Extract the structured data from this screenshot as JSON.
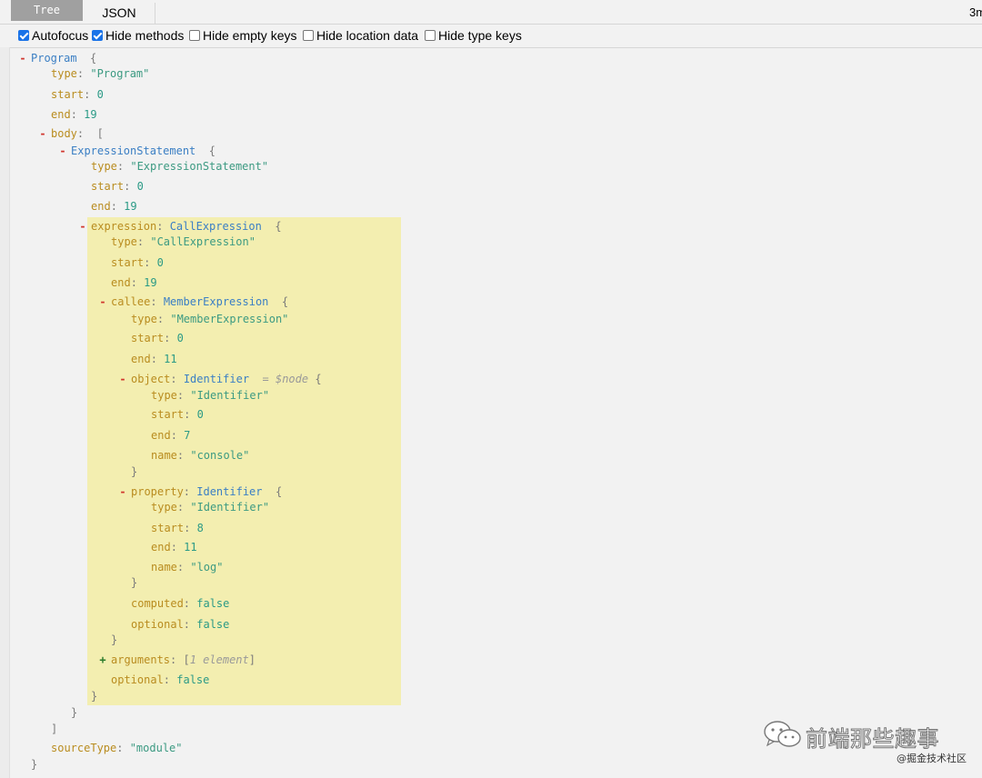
{
  "tabs": {
    "tree": "Tree",
    "json": "JSON",
    "timing": "3m"
  },
  "options": [
    {
      "label": "Autofocus",
      "checked": true
    },
    {
      "label": "Hide methods",
      "checked": true
    },
    {
      "label": "Hide empty keys",
      "checked": false
    },
    {
      "label": "Hide location data",
      "checked": false
    },
    {
      "label": "Hide type keys",
      "checked": false
    }
  ],
  "tree": {
    "program": {
      "label": "Program",
      "open": "{",
      "close": "}"
    },
    "type_key": "type",
    "start_key": "start",
    "end_key": "end",
    "body_key": "body",
    "name_key": "name",
    "computed_key": "computed",
    "optional_key": "optional",
    "sourcetype_key": "sourceType",
    "expression_key": "expression",
    "callee_key": "callee",
    "object_key": "object",
    "property_key": "property",
    "arguments_key": "arguments",
    "program_type": "\"Program\"",
    "program_start": "0",
    "program_end": "19",
    "body_open": "[",
    "body_close": "]",
    "exprstmt_label": "ExpressionStatement",
    "exprstmt_type": "\"ExpressionStatement\"",
    "exprstmt_start": "0",
    "exprstmt_end": "19",
    "call_label": "CallExpression",
    "call_type": "\"CallExpression\"",
    "call_start": "0",
    "call_end": "19",
    "member_label": "MemberExpression",
    "member_type": "\"MemberExpression\"",
    "member_start": "0",
    "member_end": "11",
    "object_label": "Identifier",
    "object_node_ref": "= $node",
    "object_type": "\"Identifier\"",
    "object_start": "0",
    "object_end": "7",
    "object_name": "\"console\"",
    "property_label": "Identifier",
    "property_type": "\"Identifier\"",
    "property_start": "8",
    "property_end": "11",
    "property_name": "\"log\"",
    "computed_value": "false",
    "member_optional": "false",
    "arguments_summary": "1 element",
    "call_optional": "false",
    "source_type": "\"module\""
  },
  "watermark": {
    "title": "前端那些趣事",
    "subtitle": "@掘金技术社区"
  }
}
